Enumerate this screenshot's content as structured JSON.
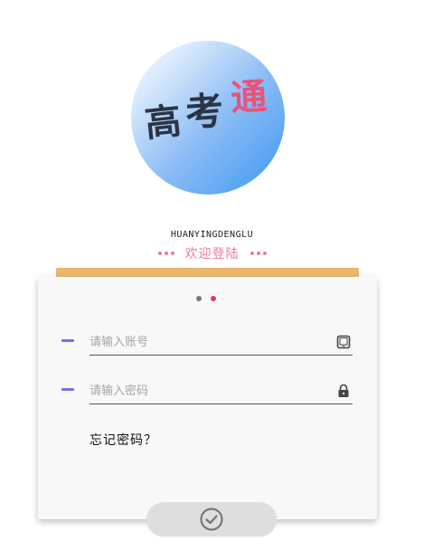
{
  "logo": {
    "char1": "高",
    "char2": "考",
    "char3": "通"
  },
  "welcome": {
    "english": "HUANYINGDENGLU",
    "chinese": "欢迎登陆"
  },
  "pager": {
    "count": 2,
    "active_index": 1,
    "inactive_color": "#7a7a7a",
    "active_color": "#e2375d"
  },
  "form": {
    "account": {
      "placeholder": "请输入账号",
      "value": "",
      "icon": "tablet-icon"
    },
    "password": {
      "placeholder": "请输入密码",
      "value": "",
      "icon": "lock-icon"
    },
    "forgot_label": "忘记密码？"
  },
  "submit": {
    "icon": "check-circle-icon"
  },
  "colors": {
    "accent_bar": "#e9b86a",
    "pink": "#e77d9b",
    "field_mark": "#7b6ee6"
  }
}
